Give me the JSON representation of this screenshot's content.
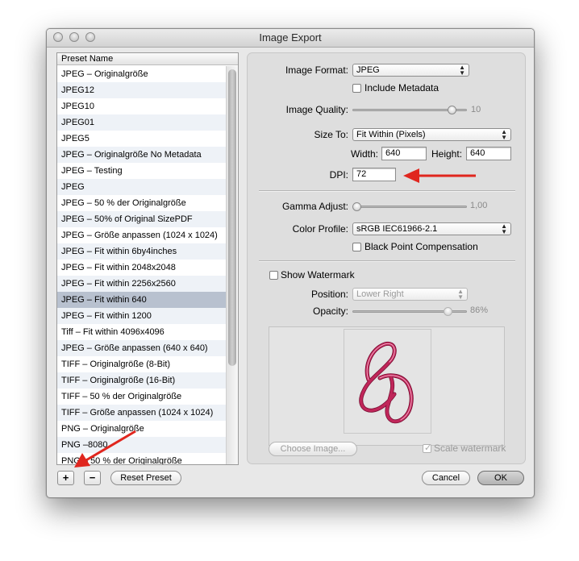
{
  "window": {
    "title": "Image Export"
  },
  "preset_list": {
    "header": "Preset Name",
    "selected_index": 14,
    "items": [
      "JPEG – Originalgröße",
      "JPEG12",
      "JPEG10",
      "JPEG01",
      "JPEG5",
      "JPEG – Originalgröße No Metadata",
      "JPEG – Testing",
      "JPEG",
      "JPEG – 50 % der Originalgröße",
      "JPEG – 50% of Original SizePDF",
      "JPEG – Größe anpassen (1024 x 1024)",
      "JPEG – Fit within 6by4inches",
      "JPEG – Fit within 2048x2048",
      "JPEG – Fit within 2256x2560",
      "JPEG – Fit within 640",
      "JPEG – Fit within 1200",
      "Tiff – Fit within 4096x4096",
      "JPEG – Größe anpassen (640 x 640)",
      "TIFF – Originalgröße (8-Bit)",
      "TIFF – Originalgröße (16-Bit)",
      "TIFF – 50 % der Originalgröße",
      "TIFF – Größe anpassen (1024 x 1024)",
      "PNG – Originalgröße",
      "PNG –8080",
      "PNG – 50 % der Originalgröße"
    ]
  },
  "settings": {
    "image_format_label": "Image Format:",
    "image_format_value": "JPEG",
    "include_metadata_label": "Include Metadata",
    "include_metadata_checked": false,
    "image_quality_label": "Image Quality:",
    "image_quality_value": "10",
    "image_quality_fraction": 0.9,
    "size_to_label": "Size To:",
    "size_to_value": "Fit Within (Pixels)",
    "width_label": "Width:",
    "width_value": "640",
    "height_label": "Height:",
    "height_value": "640",
    "dpi_label": "DPI:",
    "dpi_value": "72",
    "gamma_label": "Gamma Adjust:",
    "gamma_value": "1,00",
    "gamma_fraction": 0.0,
    "color_profile_label": "Color Profile:",
    "color_profile_value": "sRGB IEC61966-2.1",
    "black_point_label": "Black Point Compensation",
    "black_point_checked": false
  },
  "watermark": {
    "show_label": "Show Watermark",
    "show_checked": false,
    "position_label": "Position:",
    "position_value": "Lower Right",
    "opacity_label": "Opacity:",
    "opacity_value": "86%",
    "opacity_fraction": 0.86,
    "choose_image_label": "Choose Image...",
    "scale_label": "Scale watermark",
    "scale_checked": true
  },
  "buttons": {
    "add": "+",
    "remove": "−",
    "reset_preset": "Reset Preset",
    "cancel": "Cancel",
    "ok": "OK"
  },
  "colors": {
    "annotation_arrow": "#e0261e",
    "selected_row": "#b8c1cf",
    "watermark_ink": "#c0265a"
  }
}
